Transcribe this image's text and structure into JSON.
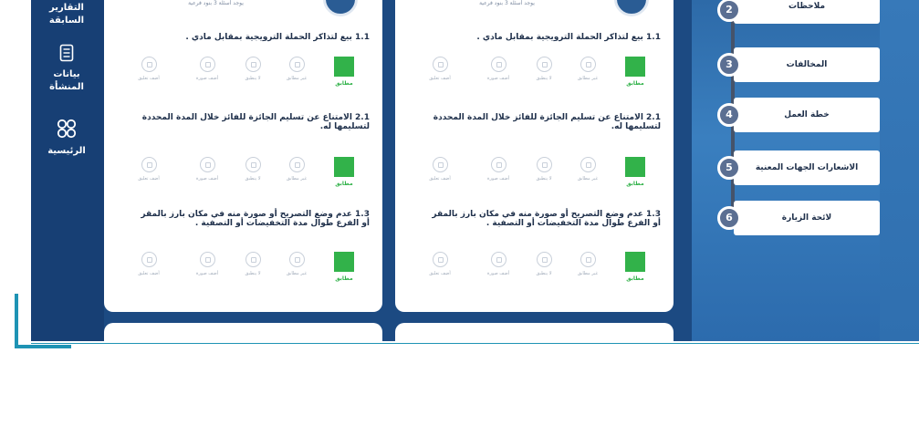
{
  "nav": {
    "reports_label": "التقارير السابقة",
    "facility_data_label": "بيانات المنشأة",
    "home_label": "الرئيسية"
  },
  "cards": [
    {
      "subtitle": "يوجد أسئلة 3 بنود فرعية",
      "items": [
        {
          "title": "1.1 بيع لتذاكر الحملة الترويجية بمقابل مادي .",
          "options": [
            "غير مطابق",
            "لا ينطبق",
            "أضف صورة",
            "أضف تعليق"
          ],
          "selected_label": "مطابق"
        },
        {
          "title": "2.1 الامتناع عن تسليم الجائزة للفائز خلال المدة المحددة لتسليمها له.",
          "options": [
            "غير مطابق",
            "لا ينطبق",
            "أضف صورة",
            "أضف تعليق"
          ],
          "selected_label": "مطابق"
        },
        {
          "title": "1.3 عدم وضع التصريح أو صورة منه في مكان بارز بالمقر أو الفرع طوال مدة التخفيضات أو التصفية .",
          "options": [
            "غير مطابق",
            "لا ينطبق",
            "أضف صورة",
            "أضف تعليق"
          ],
          "selected_label": "مطابق"
        }
      ]
    },
    {
      "subtitle": "يوجد أسئلة 3 بنود فرعية",
      "items": [
        {
          "title": "1.1 بيع لتذاكر الحملة الترويجية بمقابل مادي .",
          "options": [
            "غير مطابق",
            "لا ينطبق",
            "أضف صورة",
            "أضف تعليق"
          ],
          "selected_label": "مطابق"
        },
        {
          "title": "2.1 الامتناع عن تسليم الجائزة للفائز خلال المدة المحددة لتسليمها له.",
          "options": [
            "غير مطابق",
            "لا ينطبق",
            "أضف صورة",
            "أضف تعليق"
          ],
          "selected_label": "مطابق"
        },
        {
          "title": "1.3 عدم وضع التصريح أو صورة منه في مكان بارز بالمقر أو الفرع طوال مدة التخفيضات أو التصفية .",
          "options": [
            "غير مطابق",
            "لا ينطبق",
            "أضف صورة",
            "أضف تعليق"
          ],
          "selected_label": "مطابق"
        }
      ]
    }
  ],
  "steps": [
    {
      "number": "2",
      "label": "ملاحظات"
    },
    {
      "number": "3",
      "label": "المخالفات"
    },
    {
      "number": "4",
      "label": "خطة العمل"
    },
    {
      "number": "5",
      "label": "الاشعارات الجهات المعنية"
    },
    {
      "number": "6",
      "label": "لائحة الزيارة"
    }
  ],
  "colors": {
    "app_bg": "#1c4a82",
    "accent": "#1e93b4",
    "selected_green": "#32b24a"
  }
}
